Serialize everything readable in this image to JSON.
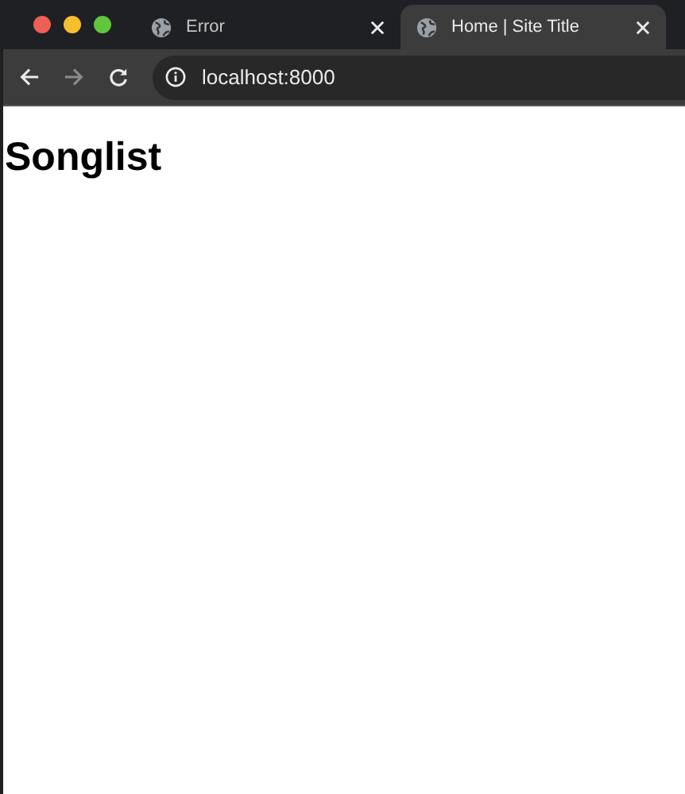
{
  "tabs": [
    {
      "title": "Error",
      "selected": false
    },
    {
      "title": "Home | Site Title",
      "selected": true
    }
  ],
  "toolbar": {
    "back_disabled": false,
    "forward_disabled": true
  },
  "address": {
    "value": "localhost:8000"
  },
  "page": {
    "heading": "Songlist"
  }
}
